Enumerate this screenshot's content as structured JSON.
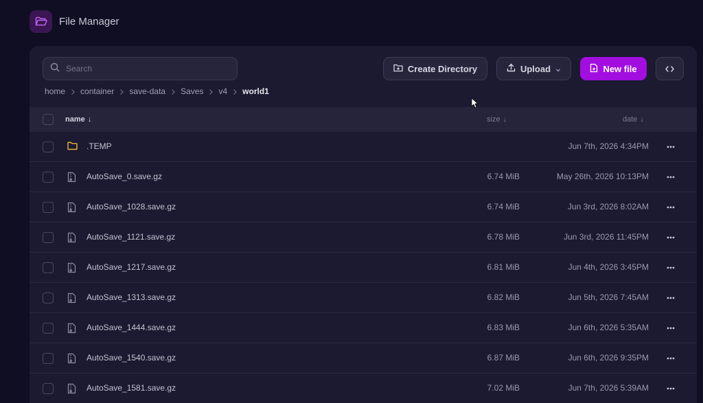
{
  "app": {
    "title": "File Manager"
  },
  "search": {
    "placeholder": "Search"
  },
  "toolbar": {
    "create_directory": "Create Directory",
    "upload": "Upload",
    "new_file": "New file"
  },
  "breadcrumb": {
    "items": [
      "home",
      "container",
      "save-data",
      "Saves",
      "v4"
    ],
    "current": "world1"
  },
  "table": {
    "headers": {
      "name": "name",
      "size": "size",
      "date": "date"
    },
    "sort_arrow": "↓",
    "rows": [
      {
        "type": "folder",
        "name": ".TEMP",
        "size": "",
        "date": "Jun 7th, 2026 4:34PM"
      },
      {
        "type": "file",
        "name": "AutoSave_0.save.gz",
        "size": "6.74 MiB",
        "date": "May 26th, 2026 10:13PM"
      },
      {
        "type": "file",
        "name": "AutoSave_1028.save.gz",
        "size": "6.74 MiB",
        "date": "Jun 3rd, 2026 8:02AM"
      },
      {
        "type": "file",
        "name": "AutoSave_1121.save.gz",
        "size": "6.78 MiB",
        "date": "Jun 3rd, 2026 11:45PM"
      },
      {
        "type": "file",
        "name": "AutoSave_1217.save.gz",
        "size": "6.81 MiB",
        "date": "Jun 4th, 2026 3:45PM"
      },
      {
        "type": "file",
        "name": "AutoSave_1313.save.gz",
        "size": "6.82 MiB",
        "date": "Jun 5th, 2026 7:45AM"
      },
      {
        "type": "file",
        "name": "AutoSave_1444.save.gz",
        "size": "6.83 MiB",
        "date": "Jun 6th, 2026 5:35AM"
      },
      {
        "type": "file",
        "name": "AutoSave_1540.save.gz",
        "size": "6.87 MiB",
        "date": "Jun 6th, 2026 9:35PM"
      },
      {
        "type": "file",
        "name": "AutoSave_1581.save.gz",
        "size": "7.02 MiB",
        "date": "Jun 7th, 2026 5:39AM"
      }
    ]
  },
  "colors": {
    "accent": "#a20ee0",
    "folder_icon": "#e5b73b",
    "logo_bg": "#3a1652",
    "logo_icon": "#b75ee8"
  },
  "icons": {
    "logo": "folder-open-icon",
    "search": "search-icon",
    "create_directory": "folder-plus-icon",
    "upload": "upload-icon",
    "upload_dropdown": "chevron-down-icon",
    "new_file": "file-plus-icon",
    "code": "code-icon",
    "folder_row": "folder-icon",
    "file_row": "archive-file-icon",
    "row_menu": "more-horizontal-icon"
  }
}
